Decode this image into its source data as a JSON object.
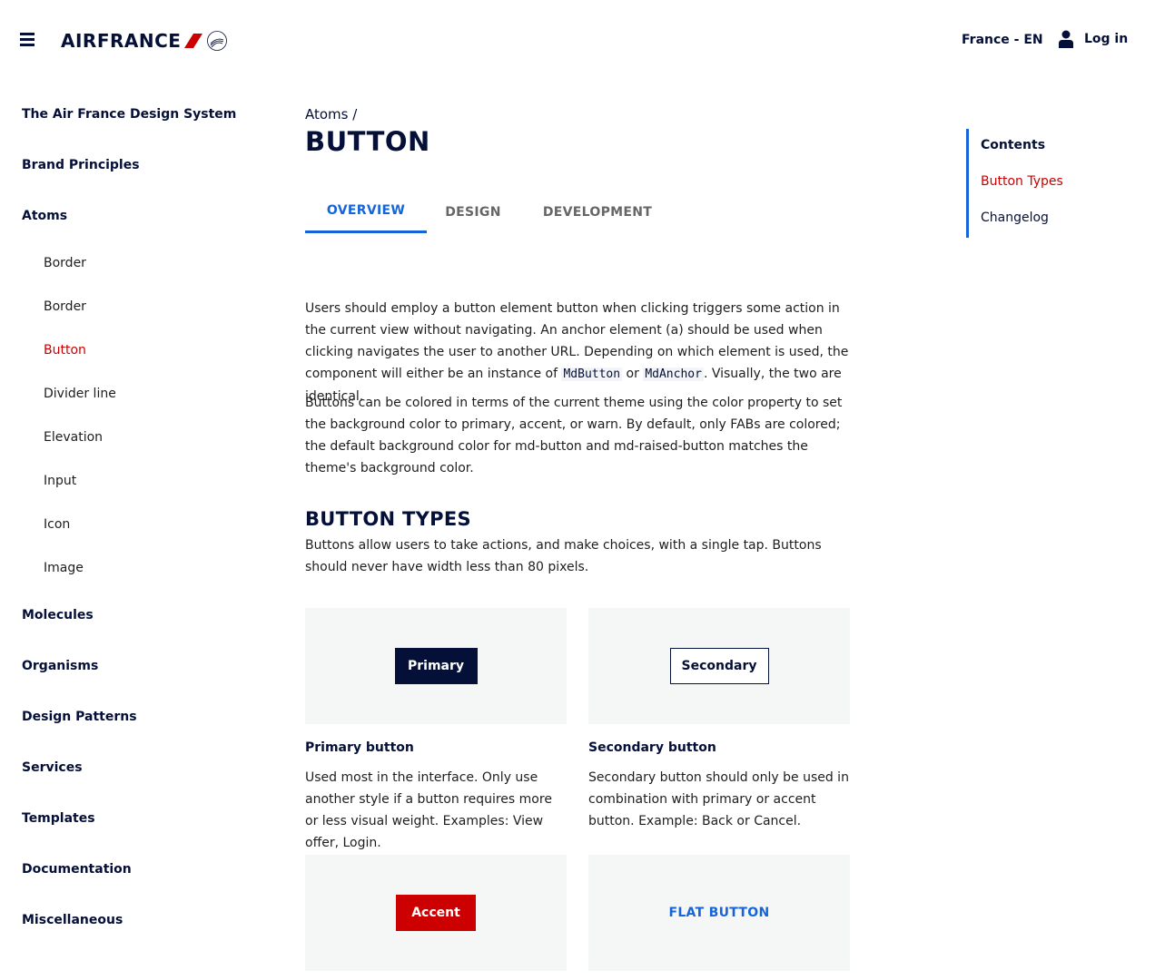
{
  "header": {
    "brand": "AIRFRANCE",
    "locale": "France - EN",
    "login_label": "Log in"
  },
  "sidebar": {
    "items": [
      {
        "label": "The Air France Design System",
        "level": "top"
      },
      {
        "label": "Brand Principles",
        "level": "top"
      },
      {
        "label": "Atoms",
        "level": "top"
      },
      {
        "label": "Border",
        "level": "sub"
      },
      {
        "label": "Border",
        "level": "sub"
      },
      {
        "label": "Button",
        "level": "sub",
        "active": true
      },
      {
        "label": "Divider line",
        "level": "sub"
      },
      {
        "label": "Elevation",
        "level": "sub"
      },
      {
        "label": "Input",
        "level": "sub"
      },
      {
        "label": "Icon",
        "level": "sub"
      },
      {
        "label": "Image",
        "level": "sub"
      },
      {
        "label": "Molecules",
        "level": "top"
      },
      {
        "label": "Organisms",
        "level": "top"
      },
      {
        "label": "Design Patterns",
        "level": "top"
      },
      {
        "label": "Services",
        "level": "top"
      },
      {
        "label": "Templates",
        "level": "top"
      },
      {
        "label": "Documentation",
        "level": "top"
      },
      {
        "label": "Miscellaneous",
        "level": "top"
      }
    ]
  },
  "main": {
    "breadcrumb": "Atoms",
    "breadcrumb_sep": "/",
    "title": "BUTTON",
    "tabs": [
      {
        "label": "OVERVIEW",
        "active": true
      },
      {
        "label": "DESIGN",
        "active": false
      },
      {
        "label": "DEVELOPMENT",
        "active": false
      }
    ],
    "intro": {
      "p1_a": "Users should employ a button element button when clicking triggers some action in the current view without navigating. An anchor element (a) should be used when clicking navigates the user to another URL. Depending on which element is used, the component will either be an instance of ",
      "p1_code1": "MdButton",
      "p1_or": " or ",
      "p1_code2": "MdAnchor",
      "p1_end": ". Visually, the two are identical.",
      "p2": "Buttons can be colored in terms of the current theme using the color property to set the background color to primary, accent, or warn. By default, only FABs are colored; the default background color for md-button and md-raised-button matches the theme's background color."
    },
    "button_types": {
      "title": "BUTTON TYPES",
      "description": "Buttons allow users to take actions, and make choices, with a single tap. Buttons should never have width less than 80 pixels.",
      "cards": [
        {
          "button_label": "Primary",
          "title": "Primary button",
          "description": "Used most in the interface. Only use another style if a button requires more or less visual weight. Examples: View offer, Login."
        },
        {
          "button_label": "Secondary",
          "title": "Secondary button",
          "description": "Secondary button should only be used in combination with primary or accent button. Example: Back or Cancel."
        },
        {
          "button_label": "Accent"
        },
        {
          "button_label": "FLAT BUTTON"
        }
      ]
    }
  },
  "contents": {
    "heading": "Contents",
    "items": [
      {
        "label": "Button Types",
        "active": true
      },
      {
        "label": "Changelog",
        "active": false
      }
    ]
  },
  "colors": {
    "navy": "#051039",
    "red": "#cc0000",
    "blue": "#1565d8",
    "card_bg": "#f5f6f6"
  }
}
